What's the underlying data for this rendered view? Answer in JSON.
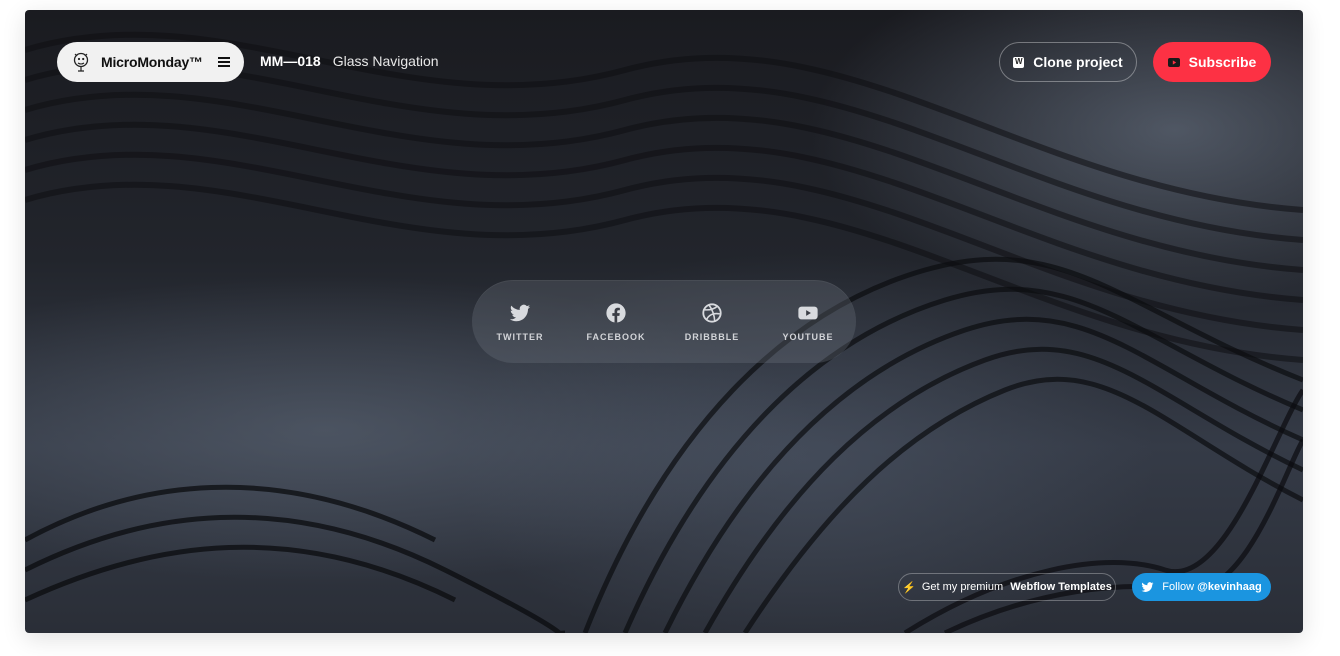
{
  "brand": {
    "name": "MicroMonday™"
  },
  "episode": {
    "code": "MM—018",
    "name": "Glass Navigation"
  },
  "actions": {
    "clone_label": "Clone project",
    "subscribe_label": "Subscribe"
  },
  "glass_nav": {
    "items": [
      {
        "label": "TWITTER",
        "icon": "twitter-icon"
      },
      {
        "label": "FACEBOOK",
        "icon": "facebook-icon"
      },
      {
        "label": "DRIBBBLE",
        "icon": "dribbble-icon"
      },
      {
        "label": "YOUTUBE",
        "icon": "youtube-icon"
      }
    ]
  },
  "footer": {
    "promo_prefix": "Get my premium",
    "promo_bold": "Webflow Templates",
    "follow_prefix": "Follow",
    "follow_handle": "@kevinhaag"
  },
  "colors": {
    "subscribe_bg": "#fd3144",
    "follow_bg": "#1b95e0",
    "bolt": "#ffd43b"
  }
}
